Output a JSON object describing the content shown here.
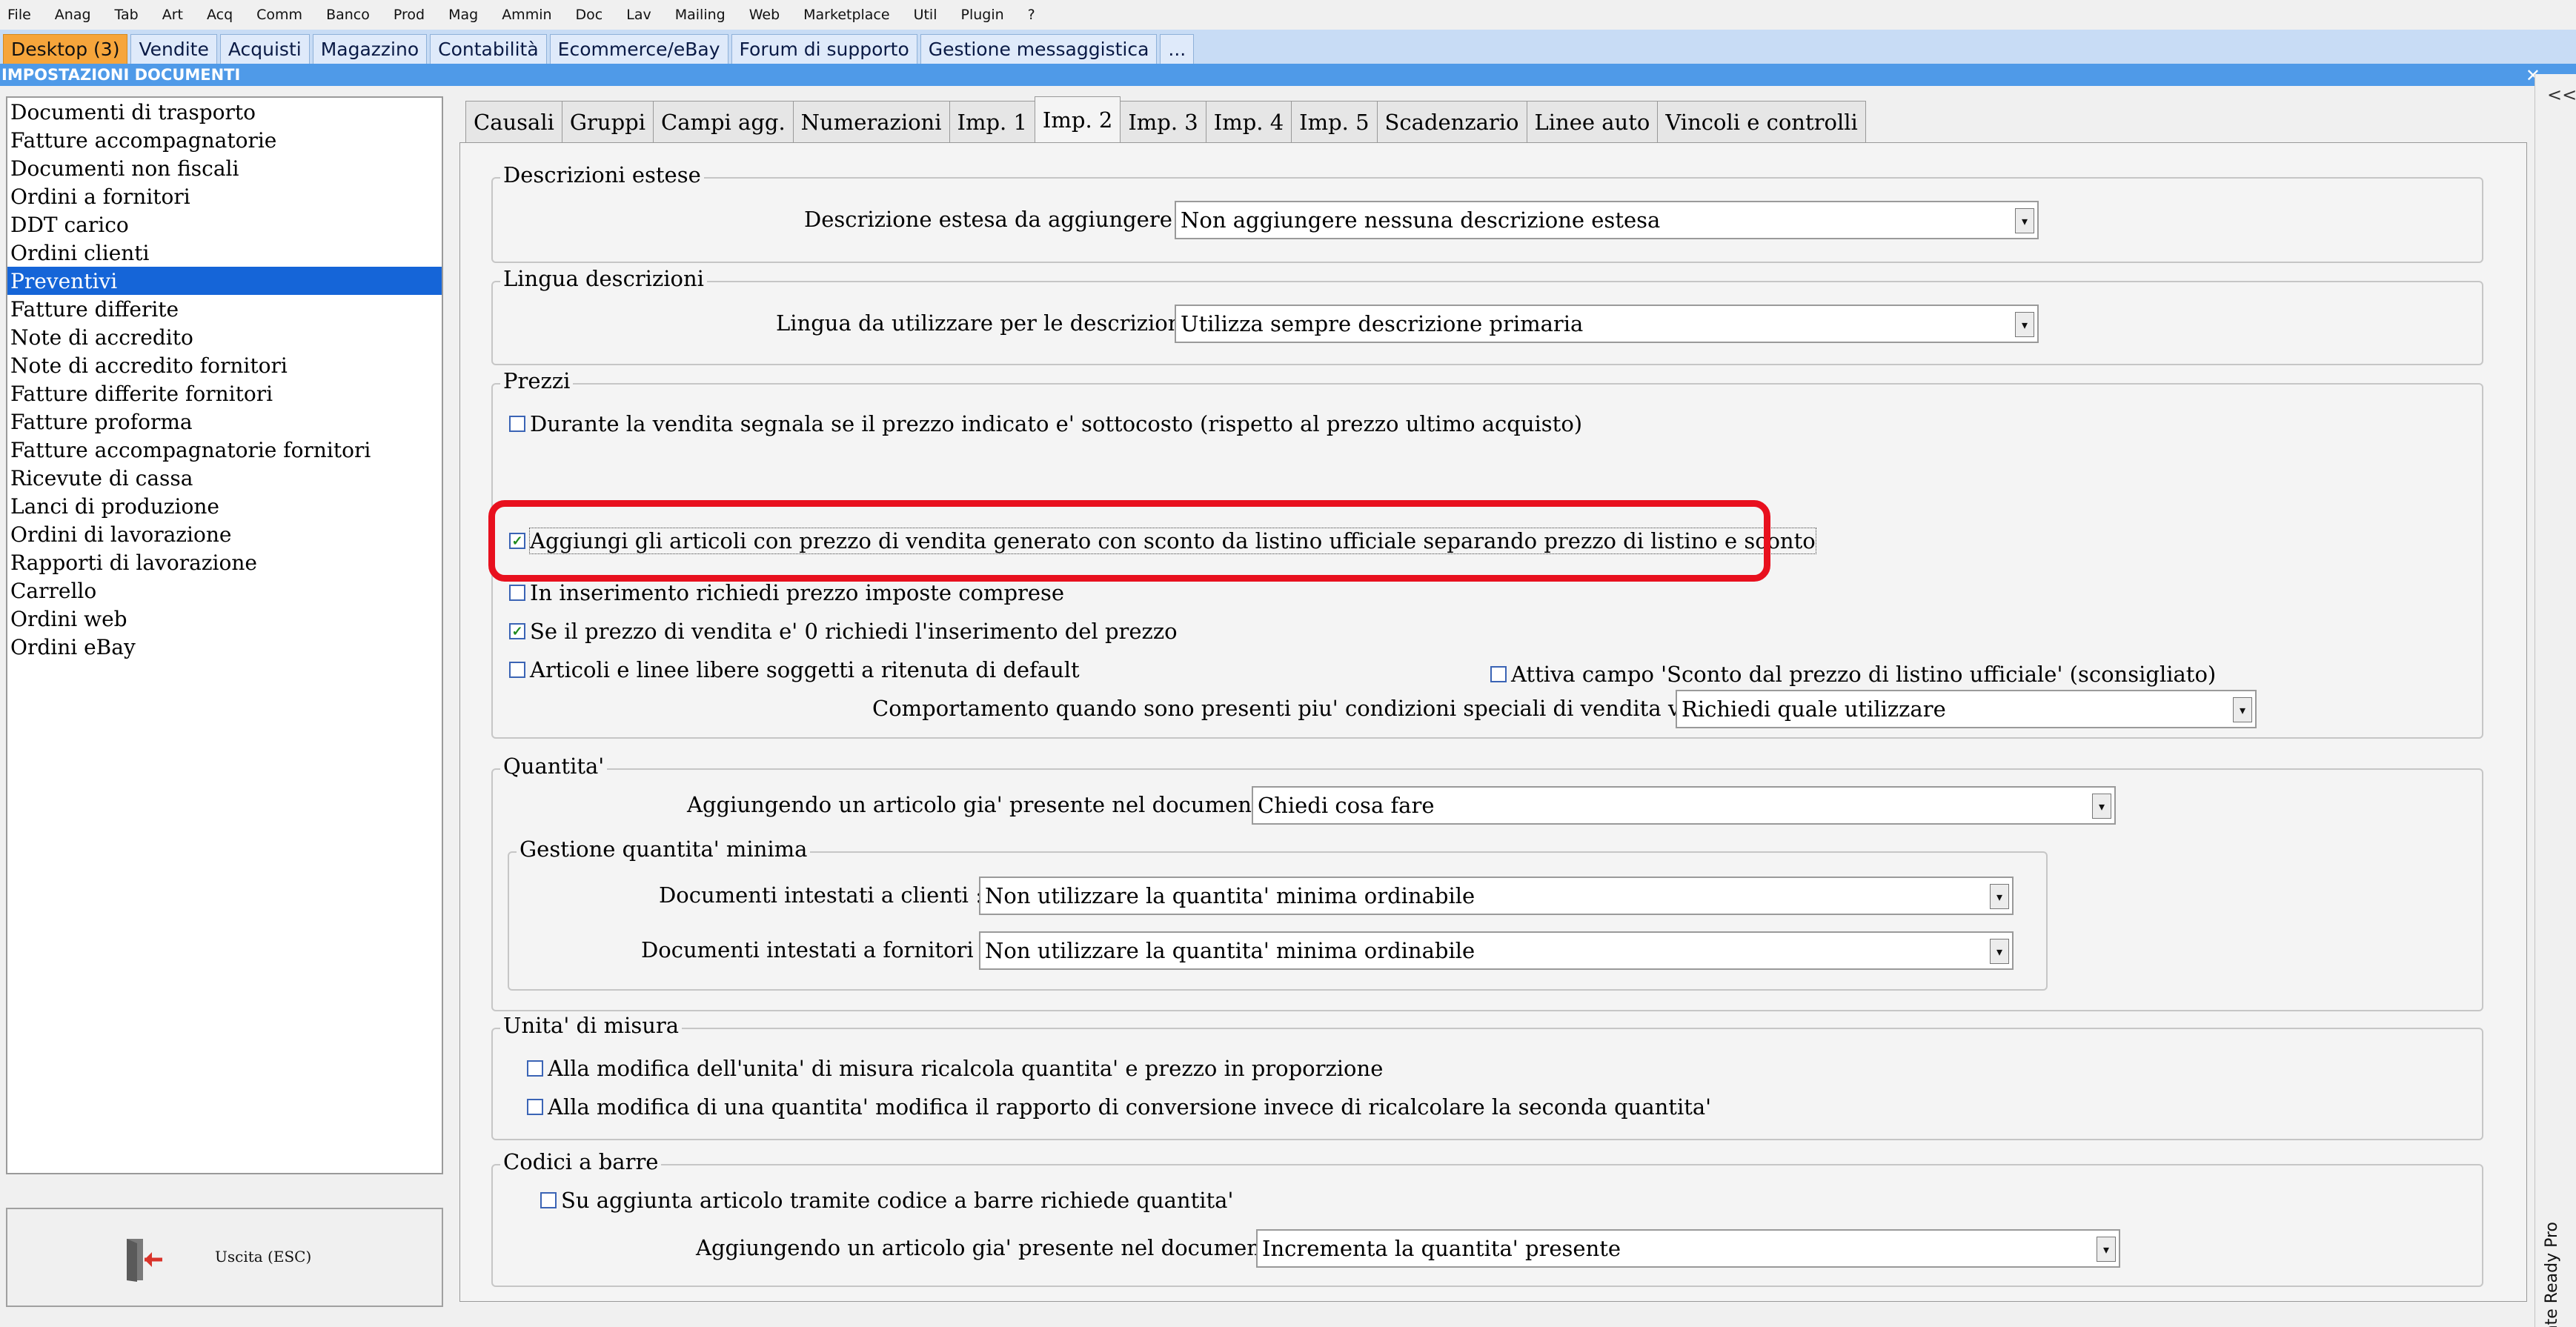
{
  "menubar": [
    "File",
    "Anag",
    "Tab",
    "Art",
    "Acq",
    "Comm",
    "Banco",
    "Prod",
    "Mag",
    "Ammin",
    "Doc",
    "Lav",
    "Mailing",
    "Web",
    "Marketplace",
    "Util",
    "Plugin",
    "?"
  ],
  "apptabs": [
    "Desktop (3)",
    "Vendite",
    "Acquisti",
    "Magazzino",
    "Contabilità",
    "Ecommerce/eBay",
    "Forum di supporto",
    "Gestione messaggistica",
    "..."
  ],
  "window_title": "IMPOSTAZIONI DOCUMENTI",
  "close_glyph": "✕",
  "doc_types": [
    "Documenti di trasporto",
    "Fatture accompagnatorie",
    "Documenti non fiscali",
    "Ordini a fornitori",
    "DDT carico",
    "Ordini clienti",
    "Preventivi",
    "Fatture differite",
    "Note di accredito",
    "Note di accredito fornitori",
    "Fatture differite fornitori",
    "Fatture proforma",
    "Fatture accompagnatorie fornitori",
    "Ricevute di cassa",
    "Lanci di produzione",
    "Ordini di lavorazione",
    "Rapporti di lavorazione",
    "Carrello",
    "Ordini web",
    "Ordini eBay"
  ],
  "selected_doc_type": "Preventivi",
  "exit_label": "Uscita (ESC)",
  "side_chevron": "<<",
  "side_label": "Assistente Ready Pro",
  "settings_tabs": [
    "Causali",
    "Gruppi",
    "Campi agg.",
    "Numerazioni",
    "Imp. 1",
    "Imp. 2",
    "Imp. 3",
    "Imp. 4",
    "Imp. 5",
    "Scadenzario",
    "Linee auto",
    "Vincoli e controlli"
  ],
  "active_settings_tab": "Imp. 2",
  "desc_estese": {
    "title": "Descrizioni estese",
    "label": "Descrizione estesa da aggiungere :",
    "value": "Non aggiungere nessuna descrizione estesa"
  },
  "lingua": {
    "title": "Lingua descrizioni",
    "label": "Lingua da utilizzare per le descrizioni :",
    "value": "Utilizza sempre descrizione primaria"
  },
  "prezzi": {
    "title": "Prezzi",
    "chk_sottocosto": "Durante la vendita segnala se il prezzo indicato e' sottocosto (rispetto al prezzo ultimo acquisto)",
    "chk_listino": "Aggiungi gli articoli con prezzo di vendita generato con sconto da listino ufficiale separando prezzo di listino e sconto",
    "chk_imposte": "In inserimento richiedi prezzo imposte comprese",
    "chk_prezzo_zero": "Se il prezzo di vendita e' 0 richiedi l'inserimento del prezzo",
    "chk_ritenuta": "Articoli e linee libere soggetti a ritenuta di default",
    "chk_sconto_campo": "Attiva campo 'Sconto dal prezzo di listino ufficiale' (sconsigliato)",
    "label_condizioni": "Comportamento quando sono presenti piu' condizioni speciali di vendita valide :",
    "value_condizioni": "Richiedi quale utilizzare"
  },
  "quantita": {
    "title": "Quantita'",
    "label_presente": "Aggiungendo un articolo gia' presente nel documento :",
    "value_presente": "Chiedi cosa fare",
    "minima_title": "Gestione quantita' minima",
    "label_clienti": "Documenti intestati a clienti :",
    "value_clienti": "Non utilizzare la quantita' minima ordinabile",
    "label_fornitori": "Documenti intestati a fornitori :",
    "value_fornitori": "Non utilizzare la quantita' minima ordinabile"
  },
  "unita": {
    "title": "Unita' di misura",
    "chk_ricalcola": "Alla modifica dell'unita' di misura ricalcola quantita' e prezzo in proporzione",
    "chk_rapporto": "Alla modifica di una quantita' modifica il rapporto di conversione invece di ricalcolare la seconda quantita'"
  },
  "barcode": {
    "title": "Codici a barre",
    "chk_quantita": "Su aggiunta articolo tramite codice a barre richiede quantita'",
    "label_presente": "Aggiungendo un articolo gia' presente nel documento :",
    "value_presente": "Incrementa la quantita' presente"
  },
  "checkbox_states": {
    "sottocosto": false,
    "listino": true,
    "imposte": false,
    "prezzo_zero": true,
    "ritenuta": false,
    "sconto_campo": false,
    "ricalcola": false,
    "rapporto": false,
    "barcode_quantita": false
  },
  "colors": {
    "selection": "#1565d8",
    "active_app_tab": "#f6a53b",
    "titlebar": "#4f9ae8",
    "highlight": "#e8101e"
  },
  "icons": {
    "exit": "exit-door-icon",
    "dropdown": "chevron-down-icon",
    "check": "check-icon"
  }
}
